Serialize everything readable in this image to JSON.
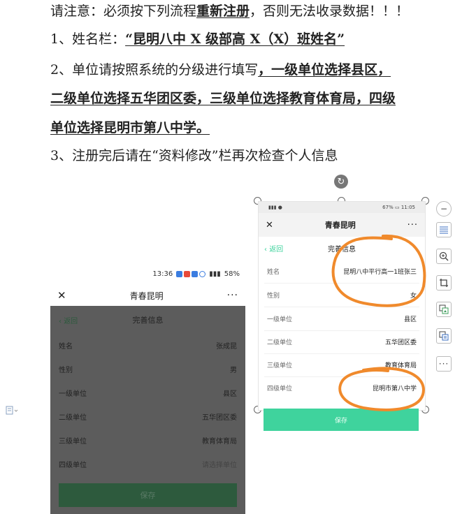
{
  "doc": {
    "line1_a": "请注意：必须按下列流程",
    "line1_b": "重新注册",
    "line1_c": "，否则无法收录数据！！！",
    "line2_a": "1、姓名栏：",
    "line2_b": "“昆明八中 X 级部高 X（X）班姓名”",
    "line3_a": "2、单位请按照系统的分级进行填写",
    "line3_b": "，一级单位选择县区，",
    "line4": "二级单位选择五华团区委，三级单位选择教育体育局，四级",
    "line5": "单位选择昆明市第八中学。",
    "line6": "3、注册完后请在“资料修改”栏再次检查个人信息"
  },
  "left_phone": {
    "status_time": "13:36",
    "status_battery": "58%",
    "app_title": "青春昆明",
    "back_label": "返回",
    "page_title": "完善信息",
    "fields": [
      {
        "label": "姓名",
        "value": "张成昆"
      },
      {
        "label": "性别",
        "value": "男"
      },
      {
        "label": "一级单位",
        "value": "县区"
      },
      {
        "label": "二级单位",
        "value": "五华团区委"
      },
      {
        "label": "三级单位",
        "value": "教育体育局"
      },
      {
        "label": "四级单位",
        "value": "请选择单位"
      }
    ],
    "save_label": "保存"
  },
  "right_phone": {
    "status_battery": "67%",
    "status_time": "11:05",
    "app_title": "青春昆明",
    "back_label": "返回",
    "page_title": "完善信息",
    "fields": [
      {
        "label": "姓名",
        "value": "昆明八中平行高一1班张三"
      },
      {
        "label": "性别",
        "value": "女"
      },
      {
        "label": "一级单位",
        "value": "县区"
      },
      {
        "label": "二级单位",
        "value": "五华团区委"
      },
      {
        "label": "三级单位",
        "value": "教育体育局"
      },
      {
        "label": "四级单位",
        "value": "昆明市第八中学"
      }
    ],
    "save_label": "保存"
  },
  "colors": {
    "annotation": "#f08a2c",
    "save_green": "#3fd39d"
  }
}
